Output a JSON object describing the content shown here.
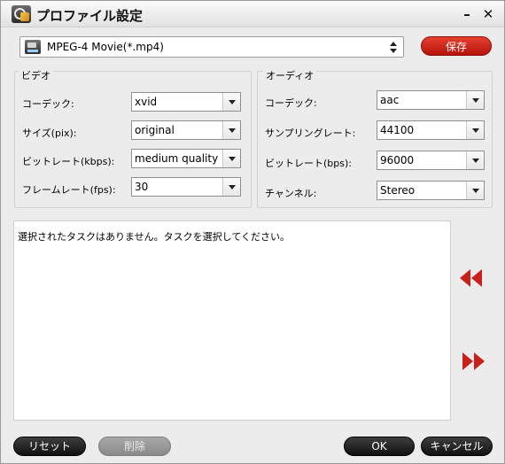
{
  "window": {
    "title": "プロファイル設定",
    "minimize_label": "–",
    "close_label": "✕"
  },
  "profile": {
    "value": "MPEG-4 Movie(*.mp4)",
    "icon": "mp4-file-icon"
  },
  "save_label": "保存",
  "video": {
    "legend": "ビデオ",
    "fields": [
      {
        "label": "コーデック:",
        "value": "xvid"
      },
      {
        "label": "サイズ(pix):",
        "value": "original"
      },
      {
        "label": "ビットレート(kbps):",
        "value": "medium quality"
      },
      {
        "label": "フレームレート(fps):",
        "value": "30"
      }
    ]
  },
  "audio": {
    "legend": "オーディオ",
    "fields": [
      {
        "label": "コーデック:",
        "value": "aac"
      },
      {
        "label": "サンプリングレート:",
        "value": "44100"
      },
      {
        "label": "ビットレート(bps):",
        "value": "96000"
      },
      {
        "label": "チャンネル:",
        "value": "Stereo"
      }
    ]
  },
  "task_message": "選択されたタスクはありません。タスクを選択してください。",
  "buttons": {
    "reset": "リセット",
    "delete": "削除",
    "ok": "OK",
    "cancel": "キャンセル"
  },
  "colors": {
    "accent_red": "#c8201a",
    "dark_button": "#1a1a1a",
    "disabled_button": "#9a9a9a"
  }
}
